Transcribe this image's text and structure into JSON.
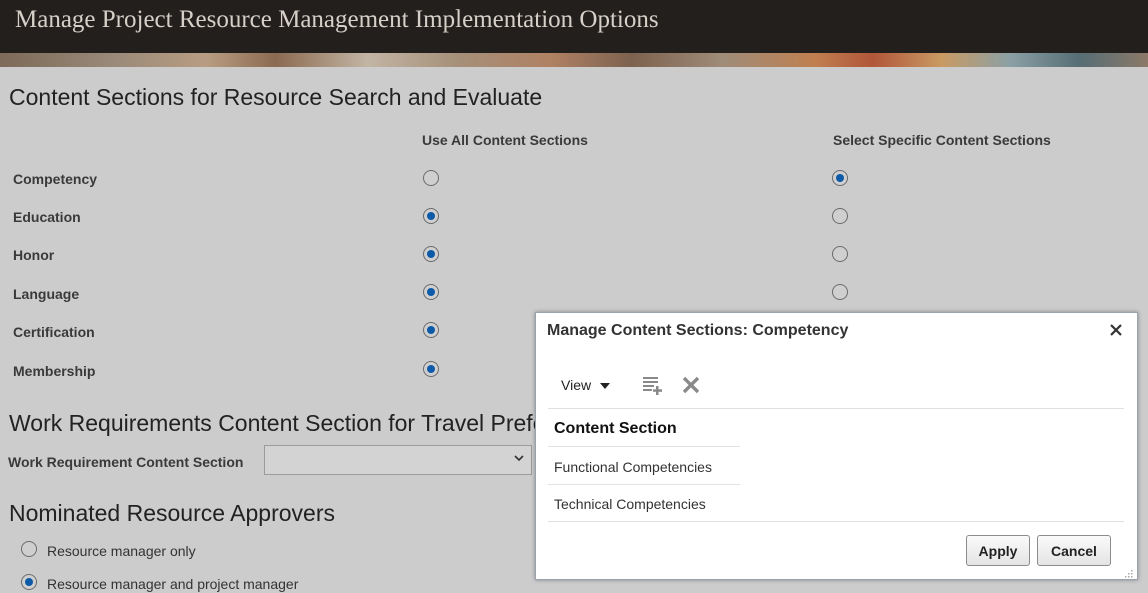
{
  "header": {
    "title": "Manage Project Resource Management Implementation Options"
  },
  "content_sections": {
    "heading": "Content Sections for Resource Search and Evaluate",
    "col_use_all": "Use All Content Sections",
    "col_select_specific": "Select Specific Content Sections",
    "rows": [
      {
        "label": "Competency",
        "selected": "specific"
      },
      {
        "label": "Education",
        "selected": "all"
      },
      {
        "label": "Honor",
        "selected": "all"
      },
      {
        "label": "Language",
        "selected": "all"
      },
      {
        "label": "Certification",
        "selected": "all"
      },
      {
        "label": "Membership",
        "selected": "all"
      }
    ]
  },
  "work_requirements": {
    "heading": "Work Requirements Content Section for Travel Preferer",
    "field_label": "Work Requirement Content Section",
    "field_value": ""
  },
  "approvers": {
    "heading": "Nominated Resource Approvers",
    "options": [
      {
        "label": "Resource manager only",
        "selected": false
      },
      {
        "label": "Resource manager and project manager",
        "selected": true
      }
    ]
  },
  "dialog": {
    "title": "Manage Content Sections: Competency",
    "view_label": "View",
    "table_header": "Content Section",
    "rows": [
      "Functional Competencies",
      "Technical Competencies"
    ],
    "apply_label": "Apply",
    "cancel_label": "Cancel",
    "icons": {
      "close": "close-icon",
      "add": "add-row-icon",
      "delete": "delete-icon",
      "view_dropdown": "caret-down-icon"
    }
  },
  "colors": {
    "header_bg": "#231f1c",
    "radio_selected": "#0c5aa8",
    "page_bg": "#cccccc"
  }
}
